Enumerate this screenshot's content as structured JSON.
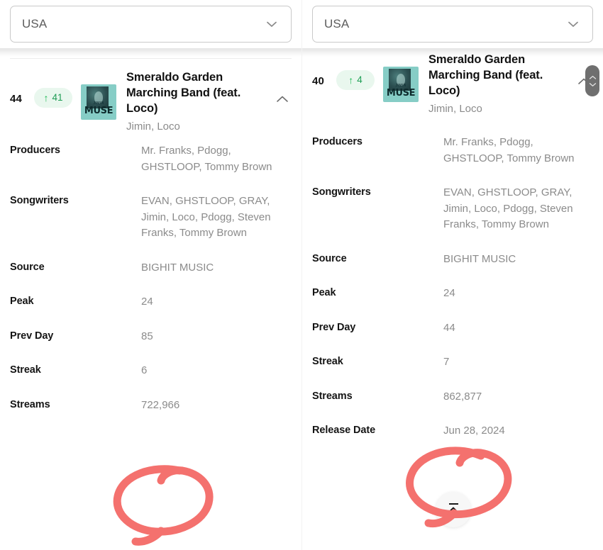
{
  "panels": [
    {
      "id": "left",
      "filter": {
        "label": "USA",
        "chevron_icon": "chevron-down-icon"
      },
      "track": {
        "rank": "44",
        "delta_arrow": "↑",
        "delta_value": "41",
        "title": "Smeraldo Garden Marching Band (feat. Loco)",
        "artist": "Jimin, Loco",
        "artwork": {
          "sub": "JIMIN",
          "title": "MUSE",
          "bg_color": "#86cdc6"
        },
        "collapse_icon": "chevron-up-icon"
      },
      "details": [
        {
          "label": "Producers",
          "value": "Mr. Franks, Pdogg, GHSTLOOP, Tommy Brown"
        },
        {
          "label": "Songwriters",
          "value": "EVAN, GHSTLOOP, GRAY, Jimin, Loco, Pdogg, Steven Franks, Tommy Brown"
        },
        {
          "label": "Source",
          "value": "BIGHIT MUSIC"
        },
        {
          "label": "Peak",
          "value": "24"
        },
        {
          "label": "Prev Day",
          "value": "85"
        },
        {
          "label": "Streak",
          "value": "6"
        },
        {
          "label": "Streams",
          "value": "722,966"
        }
      ]
    },
    {
      "id": "right",
      "filter": {
        "label": "USA",
        "chevron_icon": "chevron-down-icon"
      },
      "track": {
        "rank": "40",
        "delta_arrow": "↑",
        "delta_value": "4",
        "title": "Smeraldo Garden Marching Band (feat. Loco)",
        "artist": "Jimin, Loco",
        "artwork": {
          "sub": "JIMIN",
          "title": "MUSE",
          "bg_color": "#86cdc6"
        },
        "collapse_icon": "chevron-up-icon"
      },
      "details": [
        {
          "label": "Producers",
          "value": "Mr. Franks, Pdogg, GHSTLOOP, Tommy Brown"
        },
        {
          "label": "Songwriters",
          "value": "EVAN, GHSTLOOP, GRAY, Jimin, Loco, Pdogg, Steven Franks, Tommy Brown"
        },
        {
          "label": "Source",
          "value": "BIGHIT MUSIC"
        },
        {
          "label": "Peak",
          "value": "24"
        },
        {
          "label": "Prev Day",
          "value": "44"
        },
        {
          "label": "Streak",
          "value": "7"
        },
        {
          "label": "Streams",
          "value": "862,877"
        },
        {
          "label": "Release Date",
          "value": "Jun 28, 2024"
        }
      ]
    }
  ],
  "scrollbar": {
    "up_icon": "chevron-up-small-icon",
    "down_icon": "chevron-down-small-icon"
  },
  "fab": {
    "icon": "collapse-all-icon"
  },
  "annotations": {
    "color": "#f4716e",
    "items": [
      {
        "name": "highlight-circle-streams-left",
        "target": "722,966"
      },
      {
        "name": "highlight-circle-streams-right",
        "target": "862,877"
      }
    ]
  }
}
